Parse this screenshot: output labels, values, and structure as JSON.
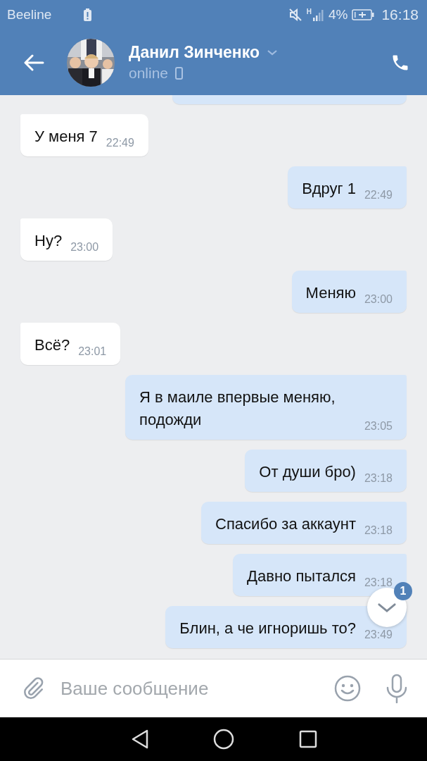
{
  "status_bar": {
    "carrier": "Beeline",
    "signal_label": "H",
    "battery_percent": "4%",
    "time": "16:18"
  },
  "header": {
    "name": "Данил Зинченко",
    "status": "online"
  },
  "messages": [
    {
      "kind": "out"
    },
    {
      "kind": "in",
      "text": "У меня 7",
      "time": "22:49"
    },
    {
      "kind": "out",
      "text": "Вдруг 1",
      "time": "22:49"
    },
    {
      "kind": "in",
      "text": "Ну?",
      "time": "23:00"
    },
    {
      "kind": "out",
      "text": "Меняю",
      "time": "23:00"
    },
    {
      "kind": "in",
      "text": "Всё?",
      "time": "23:01"
    },
    {
      "kind": "out",
      "text": "Я в маиле впервые меняю, подожди",
      "time": "23:05"
    },
    {
      "kind": "out",
      "text": "От души бро)",
      "time": "23:18"
    },
    {
      "kind": "out",
      "text": "Спасибо за аккаунт",
      "time": "23:18"
    },
    {
      "kind": "out",
      "text": "Давно пытался",
      "time": "23:18"
    },
    {
      "kind": "out",
      "text": "Блин, а че игноришь то?",
      "time": "23:49"
    }
  ],
  "scroll_down": {
    "badge": "1"
  },
  "composer": {
    "placeholder": "Ваше сообщение"
  }
}
